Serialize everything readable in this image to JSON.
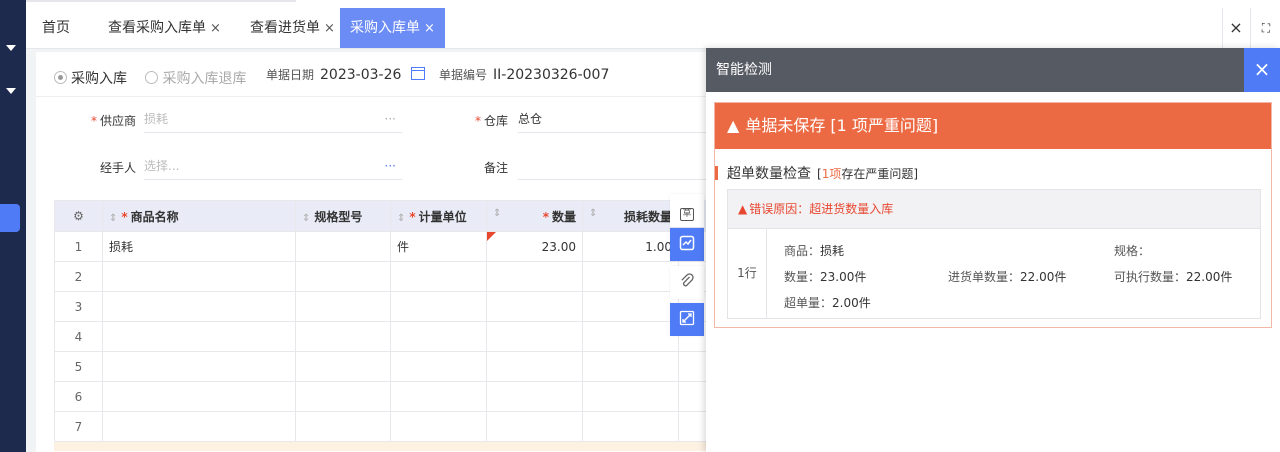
{
  "tabs": {
    "home": "首页",
    "t1": "查看采购入库单",
    "t2": "查看进货单",
    "t3": "采购入库单",
    "close_mark": "×"
  },
  "tabbar_controls": {
    "close": "×",
    "fullscreen": "⛶"
  },
  "form": {
    "radio_in": "采购入库",
    "radio_return": "采购入库退库",
    "date_label": "单据日期",
    "date_value": "2023-03-26",
    "code_label": "单据编号",
    "code_value": "II-20230326-007",
    "supplier_label": "供应商",
    "supplier_value": "损耗",
    "warehouse_label": "仓库",
    "warehouse_value": "总仓",
    "handler_label": "经手人",
    "handler_placeholder": "选择...",
    "remark_label": "备注",
    "required_mark": "*",
    "more": "···"
  },
  "grid": {
    "settings_icon": "⚙",
    "headers": {
      "name": "商品名称",
      "spec": "规格型号",
      "unit": "计量单位",
      "qty": "数量",
      "loss": "损耗数量"
    },
    "rows": [
      {
        "idx": "1",
        "name": "损耗",
        "spec": "",
        "unit": "件",
        "qty": "23.00",
        "loss": "1.00"
      },
      {
        "idx": "2",
        "name": "",
        "spec": "",
        "unit": "",
        "qty": "",
        "loss": ""
      },
      {
        "idx": "3",
        "name": "",
        "spec": "",
        "unit": "",
        "qty": "",
        "loss": ""
      },
      {
        "idx": "4",
        "name": "",
        "spec": "",
        "unit": "",
        "qty": "",
        "loss": ""
      },
      {
        "idx": "5",
        "name": "",
        "spec": "",
        "unit": "",
        "qty": "",
        "loss": ""
      },
      {
        "idx": "6",
        "name": "",
        "spec": "",
        "unit": "",
        "qty": "",
        "loss": ""
      },
      {
        "idx": "7",
        "name": "",
        "spec": "",
        "unit": "",
        "qty": "",
        "loss": ""
      }
    ]
  },
  "tools": {
    "draft": "草"
  },
  "panel": {
    "title": "智能检测",
    "close": "×",
    "alert_title": "单据未保存 [1 项严重问题]",
    "check_name": "超单数量检查",
    "check_sub_pre": "[",
    "check_sub_count": "1项",
    "check_sub_post": "存在严重问题]",
    "error_reason": "错误原因：超进货数量入库",
    "row_label": "1行",
    "goods_label": "商品：",
    "goods_value": "损耗",
    "spec_label": "规格：",
    "qty_label": "数量：",
    "qty_value": "23.00件",
    "order_qty_label": "进货单数量：",
    "order_qty_value": "22.00件",
    "exec_qty_label": "可执行数量：",
    "exec_qty_value": "22.00件",
    "over_label": "超单量：",
    "over_value": "2.00件"
  },
  "colors": {
    "accent": "#4f7cf6",
    "alert": "#ec6a43",
    "nav": "#1d2a4d"
  }
}
